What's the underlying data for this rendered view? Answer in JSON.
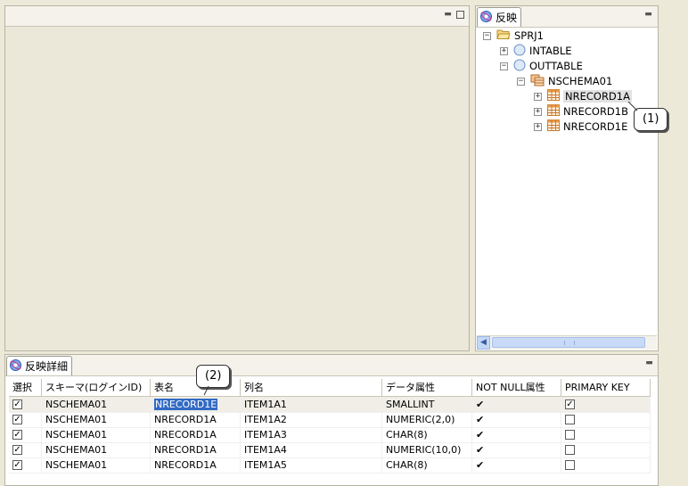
{
  "tree_view": {
    "tab_label": "反映",
    "items": [
      {
        "label": "SPRJ1",
        "expander": "−"
      },
      {
        "label": "INTABLE",
        "expander": "+"
      },
      {
        "label": "OUTTABLE",
        "expander": "−"
      },
      {
        "label": "NSCHEMA01",
        "expander": "−"
      },
      {
        "label": "NRECORD1A",
        "expander": "+"
      },
      {
        "label": "NRECORD1B",
        "expander": "+"
      },
      {
        "label": "NRECORD1E",
        "expander": "+"
      }
    ]
  },
  "detail_view": {
    "tab_label": "反映詳細",
    "columns": [
      "選択",
      "スキーマ(ログインID)",
      "表名",
      "列名",
      "データ属性",
      "NOT NULL属性",
      "PRIMARY KEY"
    ],
    "rows": [
      {
        "selected": true,
        "schema": "NSCHEMA01",
        "table": "NRECORD1E",
        "column": "ITEM1A1",
        "type": "SMALLINT",
        "not_null": true,
        "primary_key": true
      },
      {
        "selected": true,
        "schema": "NSCHEMA01",
        "table": "NRECORD1A",
        "column": "ITEM1A2",
        "type": "NUMERIC(2,0)",
        "not_null": true,
        "primary_key": false
      },
      {
        "selected": true,
        "schema": "NSCHEMA01",
        "table": "NRECORD1A",
        "column": "ITEM1A3",
        "type": "CHAR(8)",
        "not_null": true,
        "primary_key": false
      },
      {
        "selected": true,
        "schema": "NSCHEMA01",
        "table": "NRECORD1A",
        "column": "ITEM1A4",
        "type": "NUMERIC(10,0)",
        "not_null": true,
        "primary_key": false
      },
      {
        "selected": true,
        "schema": "NSCHEMA01",
        "table": "NRECORD1A",
        "column": "ITEM1A5",
        "type": "CHAR(8)",
        "not_null": true,
        "primary_key": false
      }
    ]
  },
  "callouts": {
    "one": "(1)",
    "two": "(2)"
  },
  "colors": {
    "selection": "#316AC5",
    "panel_bg": "#ECE9D8",
    "table_icon": "#D9822B"
  }
}
